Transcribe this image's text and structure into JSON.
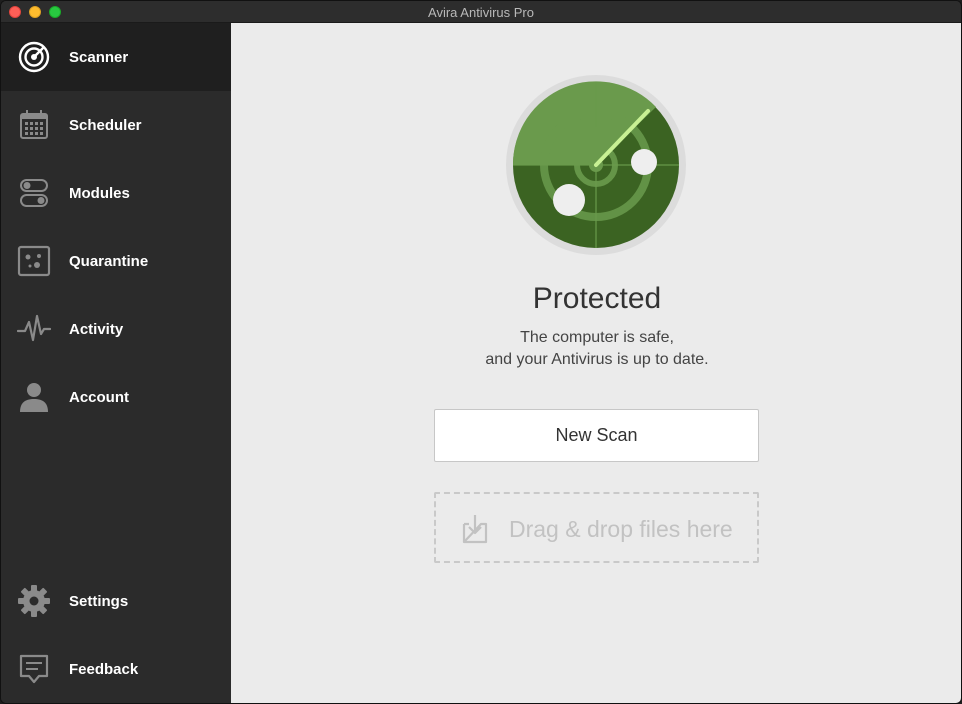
{
  "window": {
    "title": "Avira Antivirus Pro"
  },
  "sidebar": {
    "items": [
      {
        "label": "Scanner",
        "icon": "scanner-icon",
        "active": true
      },
      {
        "label": "Scheduler",
        "icon": "calendar-icon"
      },
      {
        "label": "Modules",
        "icon": "toggles-icon"
      },
      {
        "label": "Quarantine",
        "icon": "quarantine-icon"
      },
      {
        "label": "Activity",
        "icon": "pulse-icon"
      },
      {
        "label": "Account",
        "icon": "user-icon"
      }
    ],
    "bottom_items": [
      {
        "label": "Settings",
        "icon": "gear-icon"
      },
      {
        "label": "Feedback",
        "icon": "feedback-icon"
      }
    ]
  },
  "main": {
    "status_title": "Protected",
    "status_line1": "The computer is safe,",
    "status_line2": "and your Antivirus is up to date.",
    "new_scan_label": "New Scan",
    "drop_label": "Drag & drop files here"
  },
  "colors": {
    "radar_dark": "#3b6322",
    "radar_light": "#6a9a4c",
    "radar_line": "#c8f094",
    "sidebar_bg": "#2b2b2b",
    "main_bg": "#ebebeb"
  }
}
